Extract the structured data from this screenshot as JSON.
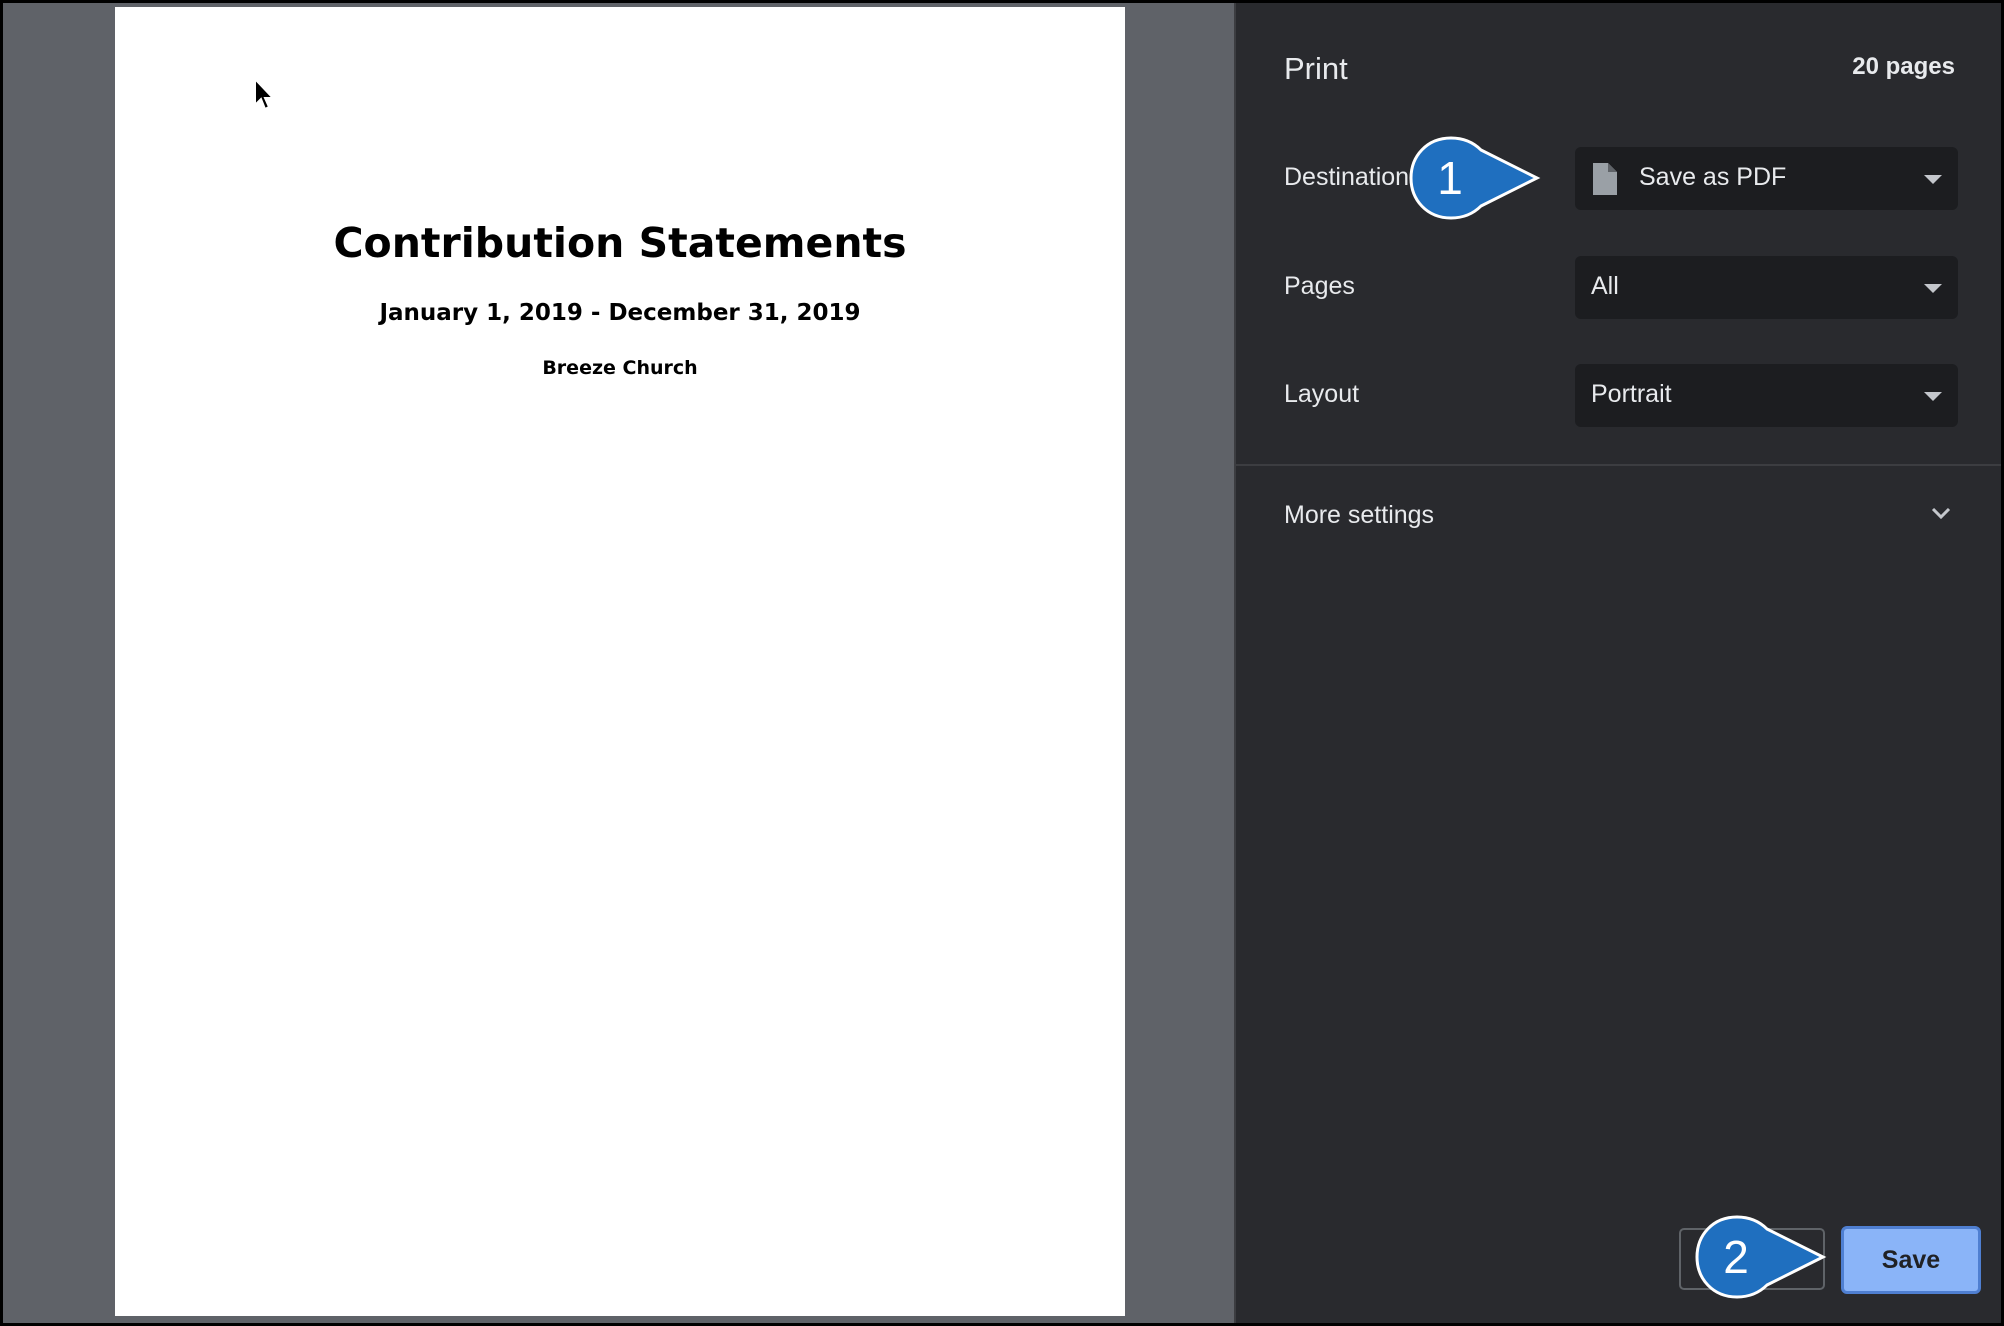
{
  "preview": {
    "title": "Contribution Statements",
    "date_range": "January 1, 2019 - December 31, 2019",
    "organization": "Breeze Church"
  },
  "print_panel": {
    "title": "Print",
    "page_count": "20 pages",
    "destination": {
      "label": "Destination",
      "value": "Save as PDF",
      "icon": "file-icon"
    },
    "pages": {
      "label": "Pages",
      "value": "All"
    },
    "layout": {
      "label": "Layout",
      "value": "Portrait"
    },
    "more_settings": "More settings",
    "save_label": "Save",
    "cancel_label": ""
  },
  "callouts": {
    "first": "1",
    "second": "2"
  },
  "colors": {
    "panel_bg": "#292a2e",
    "select_bg": "#1c1d20",
    "save_button": "#8ab4f8",
    "callout_blue": "#1f6fbf"
  }
}
